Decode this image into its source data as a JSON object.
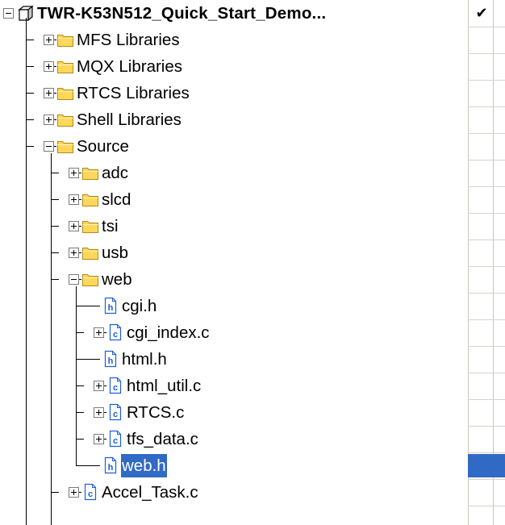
{
  "project": {
    "name": "TWR-K53N512_Quick_Start_Demo...",
    "check_mark": "✔",
    "icon": "project-cube-icon"
  },
  "tree": [
    {
      "label": "MFS Libraries",
      "type": "folder",
      "expanded": false
    },
    {
      "label": "MQX Libraries",
      "type": "folder",
      "expanded": false
    },
    {
      "label": "RTCS Libraries",
      "type": "folder",
      "expanded": false
    },
    {
      "label": "Shell Libraries",
      "type": "folder",
      "expanded": false
    },
    {
      "label": "Source",
      "type": "folder",
      "expanded": true
    },
    {
      "label": "adc",
      "type": "folder",
      "expanded": false
    },
    {
      "label": "slcd",
      "type": "folder",
      "expanded": false
    },
    {
      "label": "tsi",
      "type": "folder",
      "expanded": false
    },
    {
      "label": "usb",
      "type": "folder",
      "expanded": false
    },
    {
      "label": "web",
      "type": "folder",
      "expanded": true
    },
    {
      "label": "cgi.h",
      "type": "h-file"
    },
    {
      "label": "cgi_index.c",
      "type": "c-file",
      "expandable": true
    },
    {
      "label": "html.h",
      "type": "h-file"
    },
    {
      "label": "html_util.c",
      "type": "c-file",
      "expandable": true
    },
    {
      "label": "RTCS.c",
      "type": "c-file",
      "expandable": true
    },
    {
      "label": "tfs_data.c",
      "type": "c-file",
      "expandable": true
    },
    {
      "label": "web.h",
      "type": "h-file",
      "selected": true
    },
    {
      "label": "Accel_Task.c",
      "type": "c-file",
      "expandable": true
    }
  ],
  "colors": {
    "selection": "#316ac5",
    "folder": "#ffd75a",
    "file_icon_accent": "#1e5fd6"
  }
}
